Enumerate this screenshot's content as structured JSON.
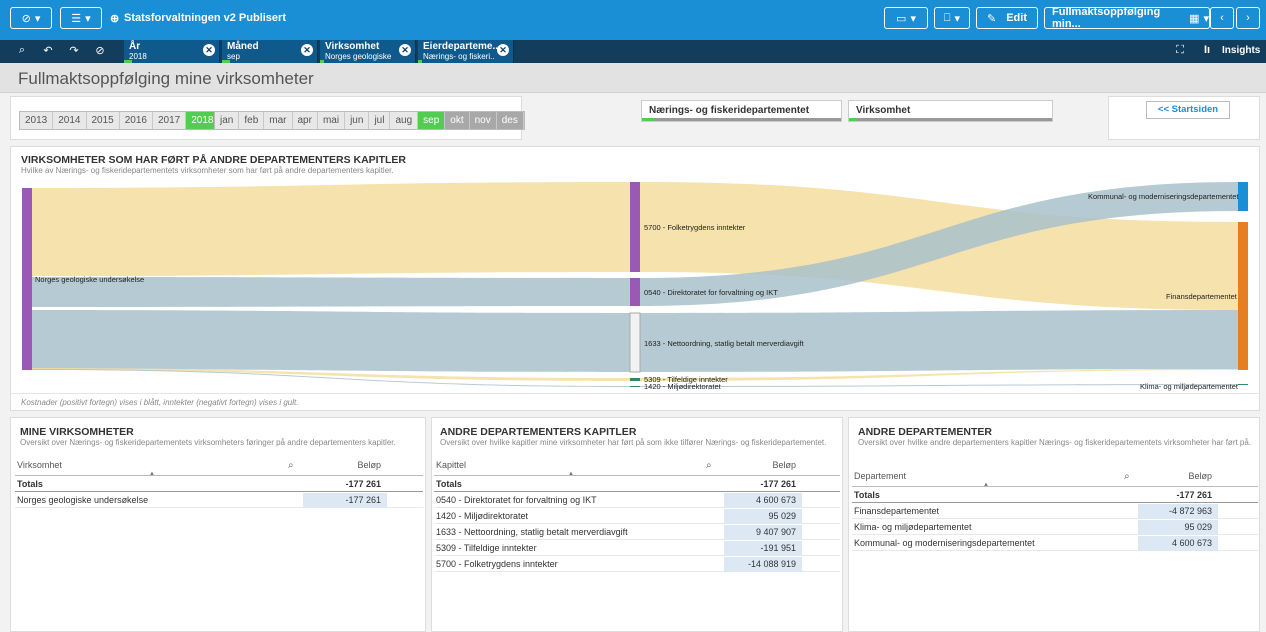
{
  "topbar": {
    "app_title": "Statsforvaltningen v2 Publisert",
    "edit_label": "Edit",
    "sheet_label": "Fullmaktsoppfølging min...",
    "accent": "#1a8fd6"
  },
  "selections": [
    {
      "field": "År",
      "value": "2018"
    },
    {
      "field": "Måned",
      "value": "sep"
    },
    {
      "field": "Virksomhet",
      "value": "Norges geologiske ..."
    },
    {
      "field": "Eierdeparteme...",
      "value": "Nærings- og fiskeri..."
    }
  ],
  "insights_label": "Insights",
  "page_title": "Fullmaktsoppfølging mine virksomheter",
  "filters": {
    "years": [
      "2013",
      "2014",
      "2015",
      "2016",
      "2017",
      "2018"
    ],
    "selected_year": "2018",
    "months": [
      "jan",
      "feb",
      "mar",
      "apr",
      "mai",
      "jun",
      "jul",
      "aug",
      "sep",
      "okt",
      "nov",
      "des"
    ],
    "selected_month": "sep",
    "dept_filter": "Nærings- og fiskeridepartementet",
    "virksomhet_filter": "Virksomhet",
    "start_button": "<< Startsiden"
  },
  "sankey": {
    "title": "VIRKSOMHETER SOM HAR FØRT PÅ ANDRE DEPARTEMENTERS KAPITLER",
    "subtitle": "Hvilke av Nærings- og fiskeridepartementets virksomheter som har ført på andre departementers kapitler.",
    "source": "Norges geologiske undersøkelse",
    "chapters": [
      "5700 - Folketrygdens inntekter",
      "0540 - Direktoratet for forvaltning og IKT",
      "1633 - Nettoordning, statlig betalt merverdiavgift",
      "5309 - Tilfeldige inntekter",
      "1420 - Miljødirektoratet"
    ],
    "departments": [
      "Kommunal- og moderniseringsdepartementet",
      "Finansdepartementet",
      "Klima- og miljødepartementet"
    ],
    "footnote": "Kostnader (positivt fortegn) vises i blått, inntekter (negativt fortegn) vises i gult.",
    "colors": {
      "cost": "#a9c1cb",
      "income": "#f3dd9d",
      "source": "#9b59b6",
      "kmd": "#1a8fd6",
      "fin": "#e67e22"
    }
  },
  "table1": {
    "title": "MINE VIRKSOMHETER",
    "subtitle": "Oversikt over Nærings- og fiskeridepartementets virksomheters føringer på andre departementers kapitler.",
    "col1": "Virksomhet",
    "col2": "Beløp",
    "totals_label": "Totals",
    "totals_value": "-177 261",
    "rows": [
      {
        "name": "Norges geologiske undersøkelse",
        "value": "-177 261"
      }
    ]
  },
  "table2": {
    "title": "ANDRE DEPARTEMENTERS KAPITLER",
    "subtitle": "Oversikt over hvilke kapitler mine virksomheter har ført på som ikke tilfører Nærings- og fiskeridepartementet.",
    "col1": "Kapittel",
    "col2": "Beløp",
    "totals_label": "Totals",
    "totals_value": "-177 261",
    "rows": [
      {
        "name": "0540 - Direktoratet for forvaltning og IKT",
        "value": "4 600 673"
      },
      {
        "name": "1420 - Miljødirektoratet",
        "value": "95 029"
      },
      {
        "name": "1633 - Nettoordning, statlig betalt merverdiavgift",
        "value": "9 407 907"
      },
      {
        "name": "5309 - Tilfeldige inntekter",
        "value": "-191 951"
      },
      {
        "name": "5700 - Folketrygdens inntekter",
        "value": "-14 088 919"
      }
    ]
  },
  "table3": {
    "title": "ANDRE DEPARTEMENTER",
    "subtitle": "Oversikt over hvilke andre departementers kapitler Nærings- og fiskeridepartementets virksomheter har ført på.",
    "col1": "Departement",
    "col2": "Beløp",
    "totals_label": "Totals",
    "totals_value": "-177 261",
    "rows": [
      {
        "name": "Finansdepartementet",
        "value": "-4 872 963"
      },
      {
        "name": "Klima- og miljødepartementet",
        "value": "95 029"
      },
      {
        "name": "Kommunal- og moderniseringsdepartementet",
        "value": "4 600 673"
      }
    ]
  }
}
